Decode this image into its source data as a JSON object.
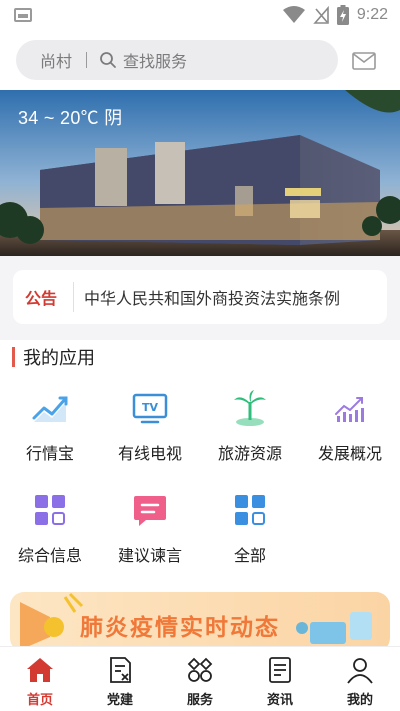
{
  "status_bar": {
    "time": "9:22"
  },
  "search": {
    "location": "尚村",
    "placeholder": "查找服务"
  },
  "banner": {
    "weather": "34 ~ 20℃ 阴",
    "building_sign": ""
  },
  "notice": {
    "tag": "公告",
    "text": "中华人民共和国外商投资法实施条例"
  },
  "apps": {
    "title": "我的应用",
    "items": [
      {
        "label": "行情宝",
        "icon": "market-chart-icon",
        "color": "#4aa3e8"
      },
      {
        "label": "有线电视",
        "icon": "tv-icon",
        "color": "#3a8fd8"
      },
      {
        "label": "旅游资源",
        "icon": "palm-tree-icon",
        "color": "#2ebd7a"
      },
      {
        "label": "发展概况",
        "icon": "growth-chart-icon",
        "color": "#9b7be0"
      },
      {
        "label": "综合信息",
        "icon": "grid-info-icon",
        "color": "#8a6fe6"
      },
      {
        "label": "建议谏言",
        "icon": "message-icon",
        "color": "#ef5f8a"
      },
      {
        "label": "全部",
        "icon": "all-apps-icon",
        "color": "#3a8fe0"
      }
    ]
  },
  "promo": {
    "title": "肺炎疫情实时动态"
  },
  "tabbar": {
    "items": [
      {
        "label": "首页",
        "icon": "home-icon",
        "active": true
      },
      {
        "label": "党建",
        "icon": "party-doc-icon",
        "active": false
      },
      {
        "label": "服务",
        "icon": "service-icon",
        "active": false
      },
      {
        "label": "资讯",
        "icon": "news-icon",
        "active": false
      },
      {
        "label": "我的",
        "icon": "profile-icon",
        "active": false
      }
    ]
  },
  "colors": {
    "accent": "#d33a32",
    "promo_text": "#f07838"
  }
}
